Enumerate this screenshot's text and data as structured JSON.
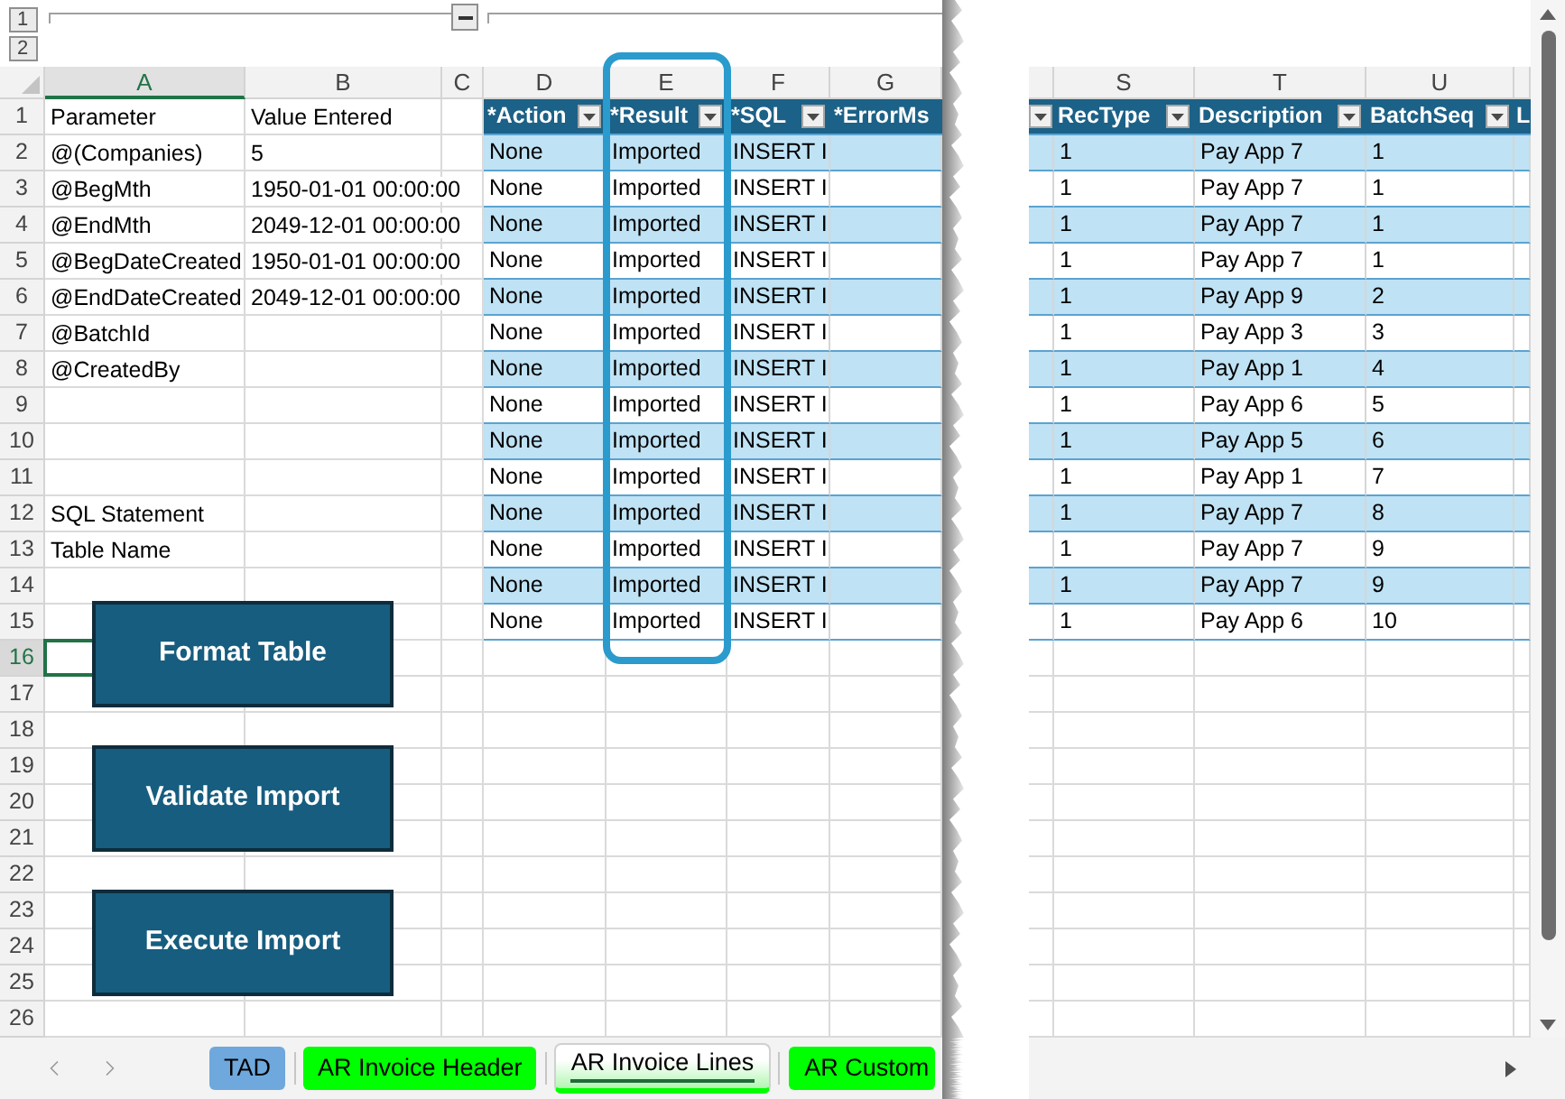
{
  "outline": {
    "levels": [
      "1",
      "2"
    ]
  },
  "sheet": {
    "columns": [
      {
        "label": "A",
        "selected": true
      },
      {
        "label": "B",
        "selected": false
      },
      {
        "label": "C",
        "selected": false
      },
      {
        "label": "D",
        "selected": false
      },
      {
        "label": "E",
        "selected": false
      },
      {
        "label": "F",
        "selected": false
      },
      {
        "label": "G",
        "selected": false
      }
    ],
    "rows": [
      {
        "number": "1",
        "selected": false,
        "cell_a": "Parameter",
        "cell_b": "Value Entered"
      },
      {
        "number": "2",
        "selected": false,
        "cell_a": "@(Companies)",
        "cell_b": "5"
      },
      {
        "number": "3",
        "selected": false,
        "cell_a": "@BegMth",
        "cell_b": "1950-01-01 00:00:00"
      },
      {
        "number": "4",
        "selected": false,
        "cell_a": "@EndMth",
        "cell_b": "2049-12-01 00:00:00"
      },
      {
        "number": "5",
        "selected": false,
        "cell_a": "@BegDateCreated",
        "cell_b": "1950-01-01 00:00:00"
      },
      {
        "number": "6",
        "selected": false,
        "cell_a": "@EndDateCreated",
        "cell_b": "2049-12-01 00:00:00"
      },
      {
        "number": "7",
        "selected": false,
        "cell_a": "@BatchId"
      },
      {
        "number": "8",
        "selected": false,
        "cell_a": "@CreatedBy"
      },
      {
        "number": "9",
        "selected": false
      },
      {
        "number": "10",
        "selected": false
      },
      {
        "number": "11",
        "selected": false
      },
      {
        "number": "12",
        "selected": false,
        "cell_a": "SQL Statement"
      },
      {
        "number": "13",
        "selected": false,
        "cell_a": "Table Name"
      },
      {
        "number": "14",
        "selected": false
      },
      {
        "number": "15",
        "selected": false
      },
      {
        "number": "16",
        "selected": true
      },
      {
        "number": "17",
        "selected": false
      },
      {
        "number": "18",
        "selected": false
      },
      {
        "number": "19",
        "selected": false
      },
      {
        "number": "20",
        "selected": false
      },
      {
        "number": "21",
        "selected": false
      },
      {
        "number": "22",
        "selected": false
      },
      {
        "number": "23",
        "selected": false
      },
      {
        "number": "24",
        "selected": false
      },
      {
        "number": "25",
        "selected": false
      },
      {
        "number": "26",
        "selected": false
      }
    ]
  },
  "import_table": {
    "headers": [
      {
        "label": "*Action",
        "highlighted": false,
        "filter_button": true
      },
      {
        "label": "*Result",
        "highlighted": true,
        "filter_button": true
      },
      {
        "label": "*SQL",
        "highlighted": false,
        "filter_button": true
      },
      {
        "label": "*ErrorMs",
        "highlighted": false,
        "filter_button": false
      }
    ],
    "rows": [
      {
        "action": "None",
        "result": "Imported",
        "sql": "INSERT I"
      },
      {
        "action": "None",
        "result": "Imported",
        "sql": "INSERT I"
      },
      {
        "action": "None",
        "result": "Imported",
        "sql": "INSERT I"
      },
      {
        "action": "None",
        "result": "Imported",
        "sql": "INSERT I"
      },
      {
        "action": "None",
        "result": "Imported",
        "sql": "INSERT I"
      },
      {
        "action": "None",
        "result": "Imported",
        "sql": "INSERT I"
      },
      {
        "action": "None",
        "result": "Imported",
        "sql": "INSERT I"
      },
      {
        "action": "None",
        "result": "Imported",
        "sql": "INSERT I"
      },
      {
        "action": "None",
        "result": "Imported",
        "sql": "INSERT I"
      },
      {
        "action": "None",
        "result": "Imported",
        "sql": "INSERT I"
      },
      {
        "action": "None",
        "result": "Imported",
        "sql": "INSERT I"
      },
      {
        "action": "None",
        "result": "Imported",
        "sql": "INSERT I"
      },
      {
        "action": "None",
        "result": "Imported",
        "sql": "INSERT I"
      },
      {
        "action": "None",
        "result": "Imported",
        "sql": "INSERT I"
      }
    ]
  },
  "right_pane": {
    "columns": [
      {
        "label": "S",
        "selected": false
      },
      {
        "label": "T",
        "selected": false
      },
      {
        "label": "U",
        "selected": false
      }
    ],
    "table": {
      "headers": [
        {
          "filter_button": true
        },
        {
          "label": "RecType",
          "filter_button": true
        },
        {
          "label": "Description",
          "filter_button": true
        },
        {
          "label": "BatchSeq",
          "filter_button": true
        },
        {
          "label": "L"
        }
      ],
      "rows": [
        {
          "rec_type": "1",
          "description": "Pay App 7",
          "batch_seq": "1"
        },
        {
          "rec_type": "1",
          "description": "Pay App 7",
          "batch_seq": "1"
        },
        {
          "rec_type": "1",
          "description": "Pay App 7",
          "batch_seq": "1"
        },
        {
          "rec_type": "1",
          "description": "Pay App 7",
          "batch_seq": "1"
        },
        {
          "rec_type": "1",
          "description": "Pay App 9",
          "batch_seq": "2"
        },
        {
          "rec_type": "1",
          "description": "Pay App 3",
          "batch_seq": "3"
        },
        {
          "rec_type": "1",
          "description": "Pay App 1",
          "batch_seq": "4"
        },
        {
          "rec_type": "1",
          "description": "Pay App 6",
          "batch_seq": "5"
        },
        {
          "rec_type": "1",
          "description": "Pay App 5",
          "batch_seq": "6"
        },
        {
          "rec_type": "1",
          "description": "Pay App 1",
          "batch_seq": "7"
        },
        {
          "rec_type": "1",
          "description": "Pay App 7",
          "batch_seq": "8"
        },
        {
          "rec_type": "1",
          "description": "Pay App 7",
          "batch_seq": "9"
        },
        {
          "rec_type": "1",
          "description": "Pay App 7",
          "batch_seq": "9"
        },
        {
          "rec_type": "1",
          "description": "Pay App 6",
          "batch_seq": "10"
        }
      ]
    }
  },
  "buttons": [
    "Format Table",
    "Validate Import",
    "Execute Import"
  ],
  "sheet_tabs": [
    {
      "label": "TAD",
      "color": "#6fa8dc",
      "selected": false
    },
    {
      "label": "AR Invoice Header",
      "color": "#00ff00",
      "selected": false
    },
    {
      "label": "AR Invoice Lines",
      "color": "#00ff00",
      "selected": true
    },
    {
      "label": "AR Custom",
      "color": "#00ff00",
      "selected": false
    }
  ]
}
